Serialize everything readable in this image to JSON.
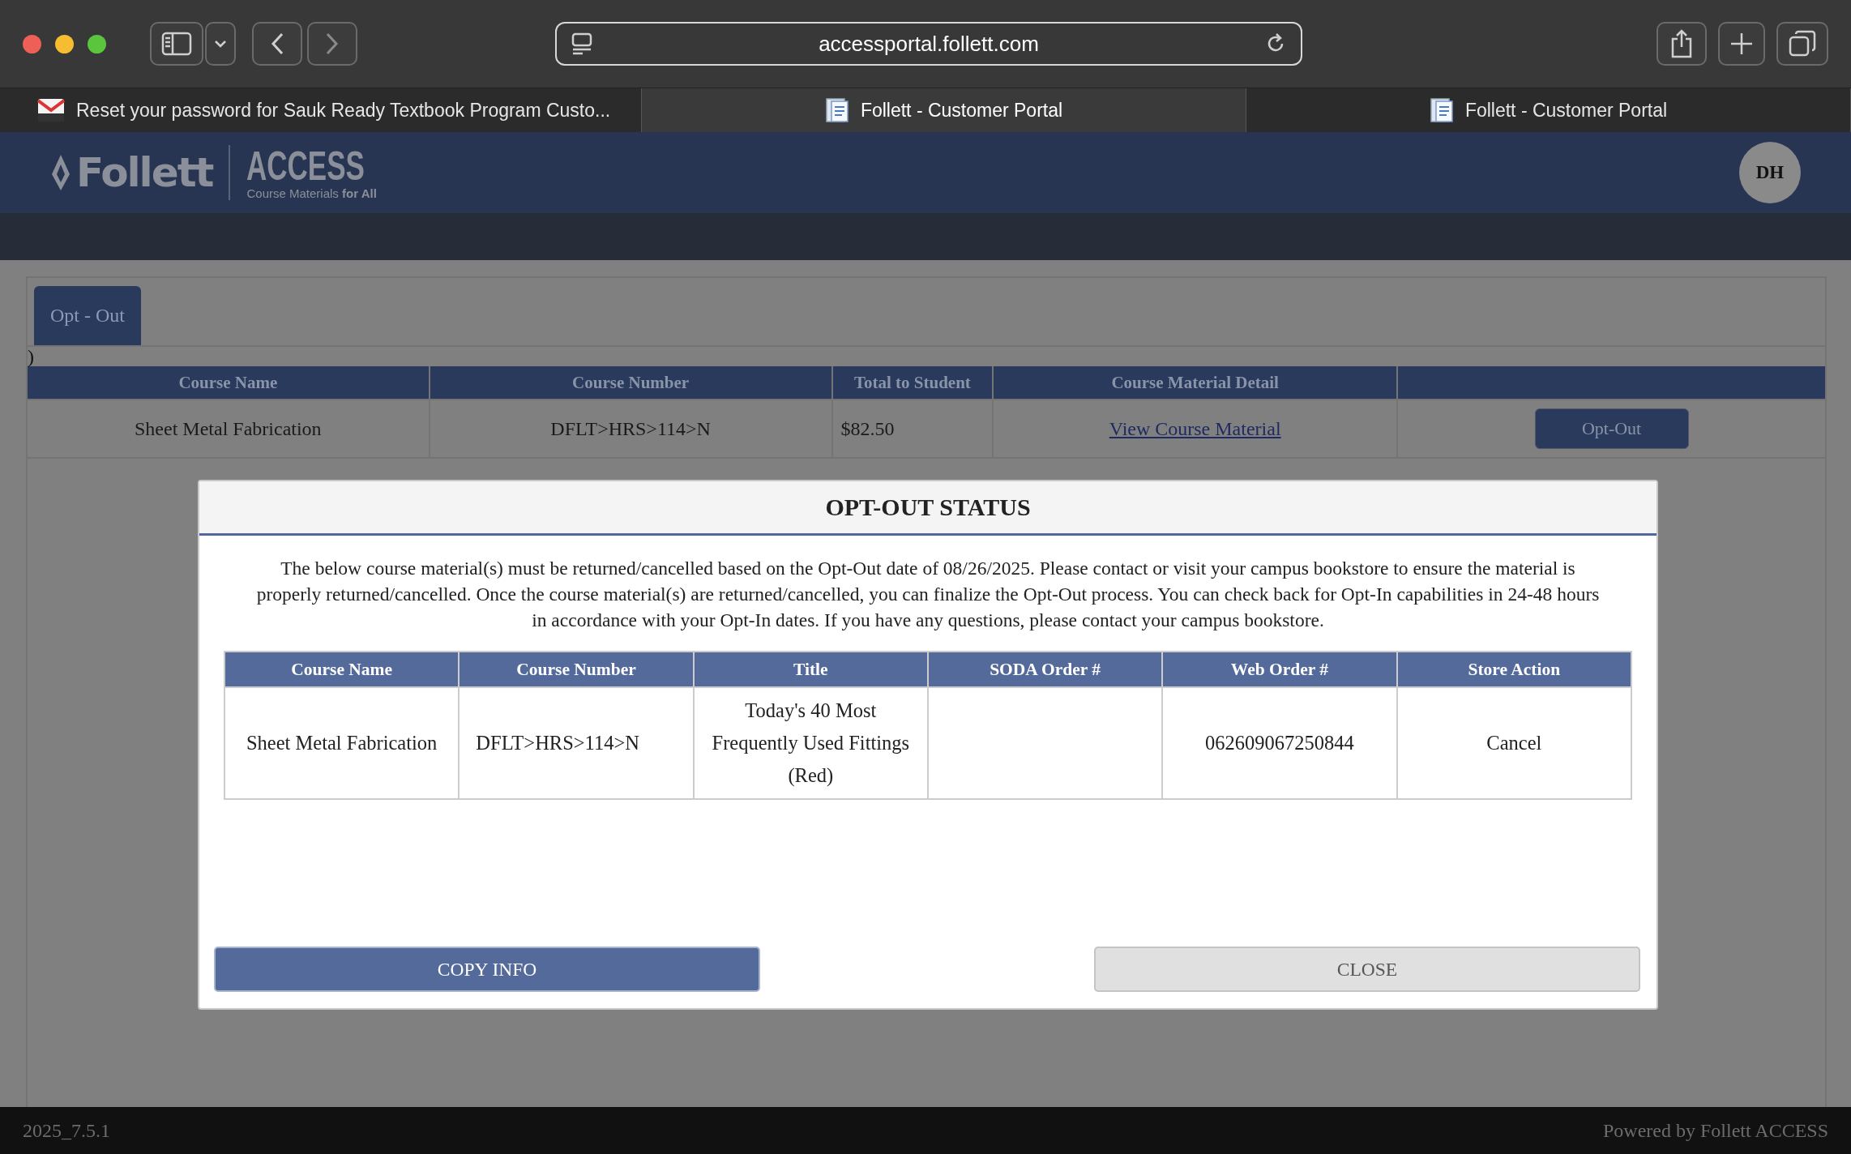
{
  "browser": {
    "url": "accessportal.follett.com",
    "tabs": [
      {
        "title": "Reset your password for Sauk Ready Textbook Program Custo...",
        "selected": false
      },
      {
        "title": "Follett - Customer Portal",
        "selected": true
      },
      {
        "title": "Follett - Customer Portal",
        "selected": false
      }
    ]
  },
  "header": {
    "brand": "Follett",
    "product": "ACCESS",
    "tagline": "Course Materials **for All**",
    "avatar": "DH"
  },
  "page": {
    "tabs": [
      {
        "label": "Opt - Out",
        "selected": true
      }
    ],
    "stray_text": ")",
    "table": {
      "columns": [
        "Course Name",
        "Course Number",
        "Total to Student",
        "Course Material Detail"
      ],
      "rows": [
        {
          "course_name": "Sheet Metal Fabrication",
          "course_number": "DFLT>HRS>114>N",
          "total": "$82.50",
          "detail_link": "View Course Material",
          "action": "Opt-Out"
        }
      ]
    }
  },
  "modal": {
    "title": "OPT-OUT STATUS",
    "message": "The below course material(s) must be returned/cancelled based on the Opt-Out date of 08/26/2025. Please contact or visit your campus bookstore to ensure the material is properly returned/cancelled. Once the course material(s) are returned/cancelled, you can finalize the Opt-Out process. You can check back for Opt-In capabilities in 24-48 hours in accordance with your Opt-In dates. If you have any questions, please contact your campus bookstore.",
    "table": {
      "columns": [
        "Course Name",
        "Course Number",
        "Title",
        "SODA Order #",
        "Web Order #",
        "Store Action"
      ],
      "rows": [
        {
          "course_name": "Sheet Metal Fabrication",
          "course_number": "DFLT>HRS>114>N",
          "title": "Today's 40 Most Frequently Used Fittings (Red)",
          "web_order": "062609067250844",
          "store_action": "Cancel"
        }
      ]
    },
    "buttons": [
      {
        "label": "COPY INFO",
        "kind": "primary"
      },
      {
        "label": "CLOSE",
        "kind": "secondary"
      }
    ]
  },
  "footer": {
    "version": "2025_7.5.1",
    "credit": "Powered by Follett ACCESS"
  }
}
